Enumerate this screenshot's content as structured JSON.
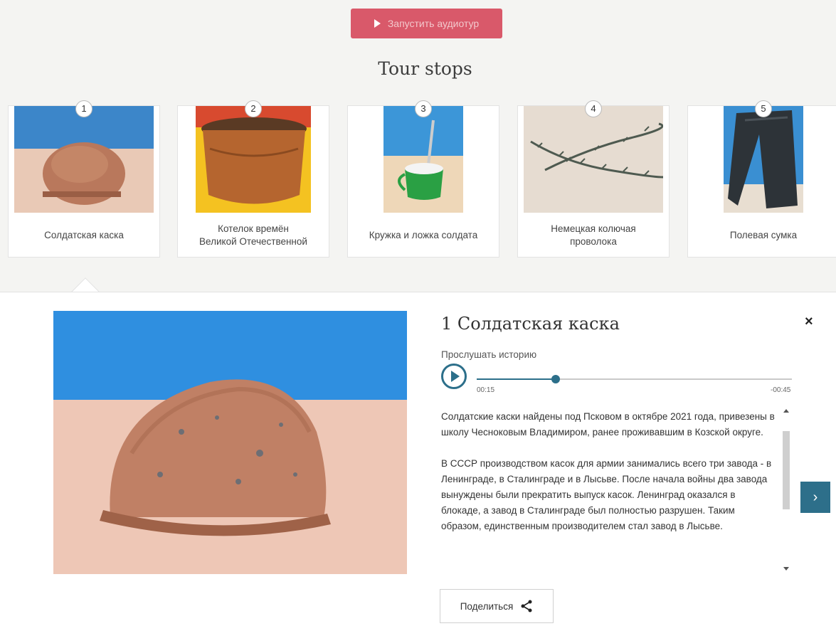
{
  "header": {
    "audio_tour_label": "Запустить аудиотур",
    "section_title": "Tour stops"
  },
  "stops": [
    {
      "num": "1",
      "label": "Солдатская каска",
      "icon": "helmet-photo"
    },
    {
      "num": "2",
      "label": "Котелок времён\nВеликой Отечественной",
      "icon": "pot-photo"
    },
    {
      "num": "3",
      "label": "Кружка и ложка солдата",
      "icon": "mug-photo"
    },
    {
      "num": "4",
      "label": "Немецкая колючая\nпроволока",
      "icon": "barbed-wire-photo"
    },
    {
      "num": "5",
      "label": "Полевая сумка",
      "icon": "field-bag-photo"
    }
  ],
  "detail": {
    "title": "1 Солдатская каска",
    "close": "×",
    "listen_label": "Прослушать историю",
    "player": {
      "elapsed": "00:15",
      "remaining": "-00:45",
      "progress": 0.25
    },
    "story": [
      "Солдатские каски найдены под Псковом в октябре 2021 года, привезены в школу Чесноковым Владимиром, ранее проживавшим в Козской округе.",
      "В СССР производством касок для армии занимались всего три завода - в Ленинграде, в Сталинграде и в Лысьве. После начала войны два завода вынуждены были прекратить выпуск касок. Ленинград оказался в блокаде, а завод в Сталинграде был полностью разрушен. Таким образом, единственным производителем стал завод в Лысьве."
    ],
    "next": "›",
    "share_label": "Поделиться"
  },
  "colors": {
    "accent": "#2c6f8a",
    "tour_button": "#d9596a"
  }
}
